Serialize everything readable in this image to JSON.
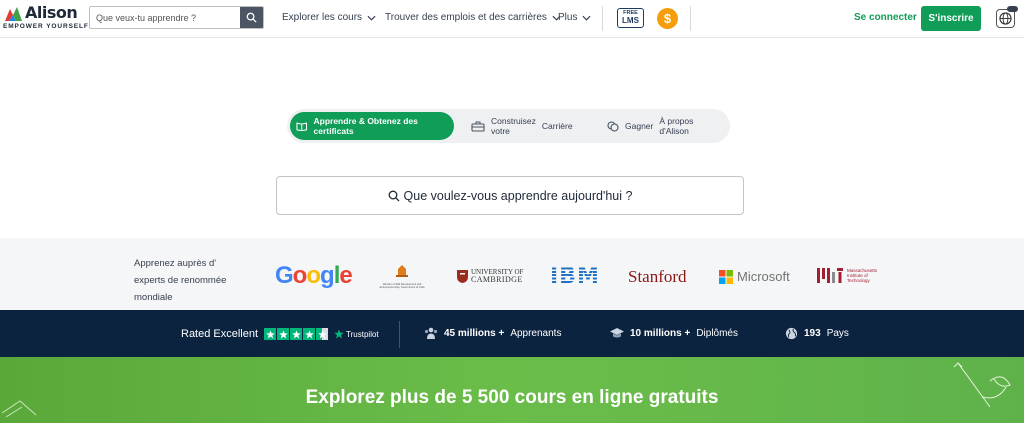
{
  "header": {
    "logo_word": "Alison",
    "logo_tagline": "EMPOWER YOURSELF",
    "search_placeholder": "Que veux-tu apprendre ?",
    "nav": [
      {
        "label": "Explorer les cours"
      },
      {
        "label": "Trouver des emplois et des carrières"
      },
      {
        "label": "Plus"
      }
    ],
    "free_lms_line1": "FREE",
    "free_lms_line2": "LMS",
    "coin_symbol": "$",
    "login_label": "Se connecter",
    "signup_label": "S'inscrire"
  },
  "tabs": [
    {
      "label": "Apprendre & Obtenez des certificats",
      "active": true
    },
    {
      "label_a": "Construisez",
      "label_b": "votre",
      "label_c": "Carrière"
    },
    {
      "label_a": "Gagner",
      "label_b": "À propos",
      "label_c": "d'Alison"
    }
  ],
  "main_search": {
    "placeholder": "Que voulez-vous apprendre aujourd'hui ?"
  },
  "partners": {
    "text_lines": [
      "Apprenez auprès d'",
      "experts de renommée",
      "mondiale"
    ],
    "logos": [
      {
        "name": "Google",
        "text": "Google"
      },
      {
        "name": "Ministry",
        "text": "Ministry of Skill Development and Entrepreneurship, Government of India"
      },
      {
        "name": "Cambridge",
        "line1": "UNIVERSITY OF",
        "line2": "CAMBRIDGE"
      },
      {
        "name": "IBM",
        "text": "IBM"
      },
      {
        "name": "Stanford",
        "text": "Stanford"
      },
      {
        "name": "Microsoft",
        "text": "Microsoft"
      },
      {
        "name": "MIT",
        "line1": "Massachusetts",
        "line2": "Institute of",
        "line3": "Technology"
      }
    ]
  },
  "stats": {
    "rated": "Rated Excellent",
    "trustpilot": "Trustpilot",
    "rating_stars": 4.5,
    "learners_value": "45 millions +",
    "learners_label": "Apprenants",
    "graduates_value": "10 millions +",
    "graduates_label": "Diplômés",
    "countries_value": "193",
    "countries_label": "Pays"
  },
  "banner": {
    "title": "Explorez plus de 5 500 cours en ligne gratuits"
  },
  "colors": {
    "brand_green": "#0f9d58",
    "navy": "#0c2340",
    "banner_green": "#6bbd4a",
    "coin": "#f59e0b"
  }
}
